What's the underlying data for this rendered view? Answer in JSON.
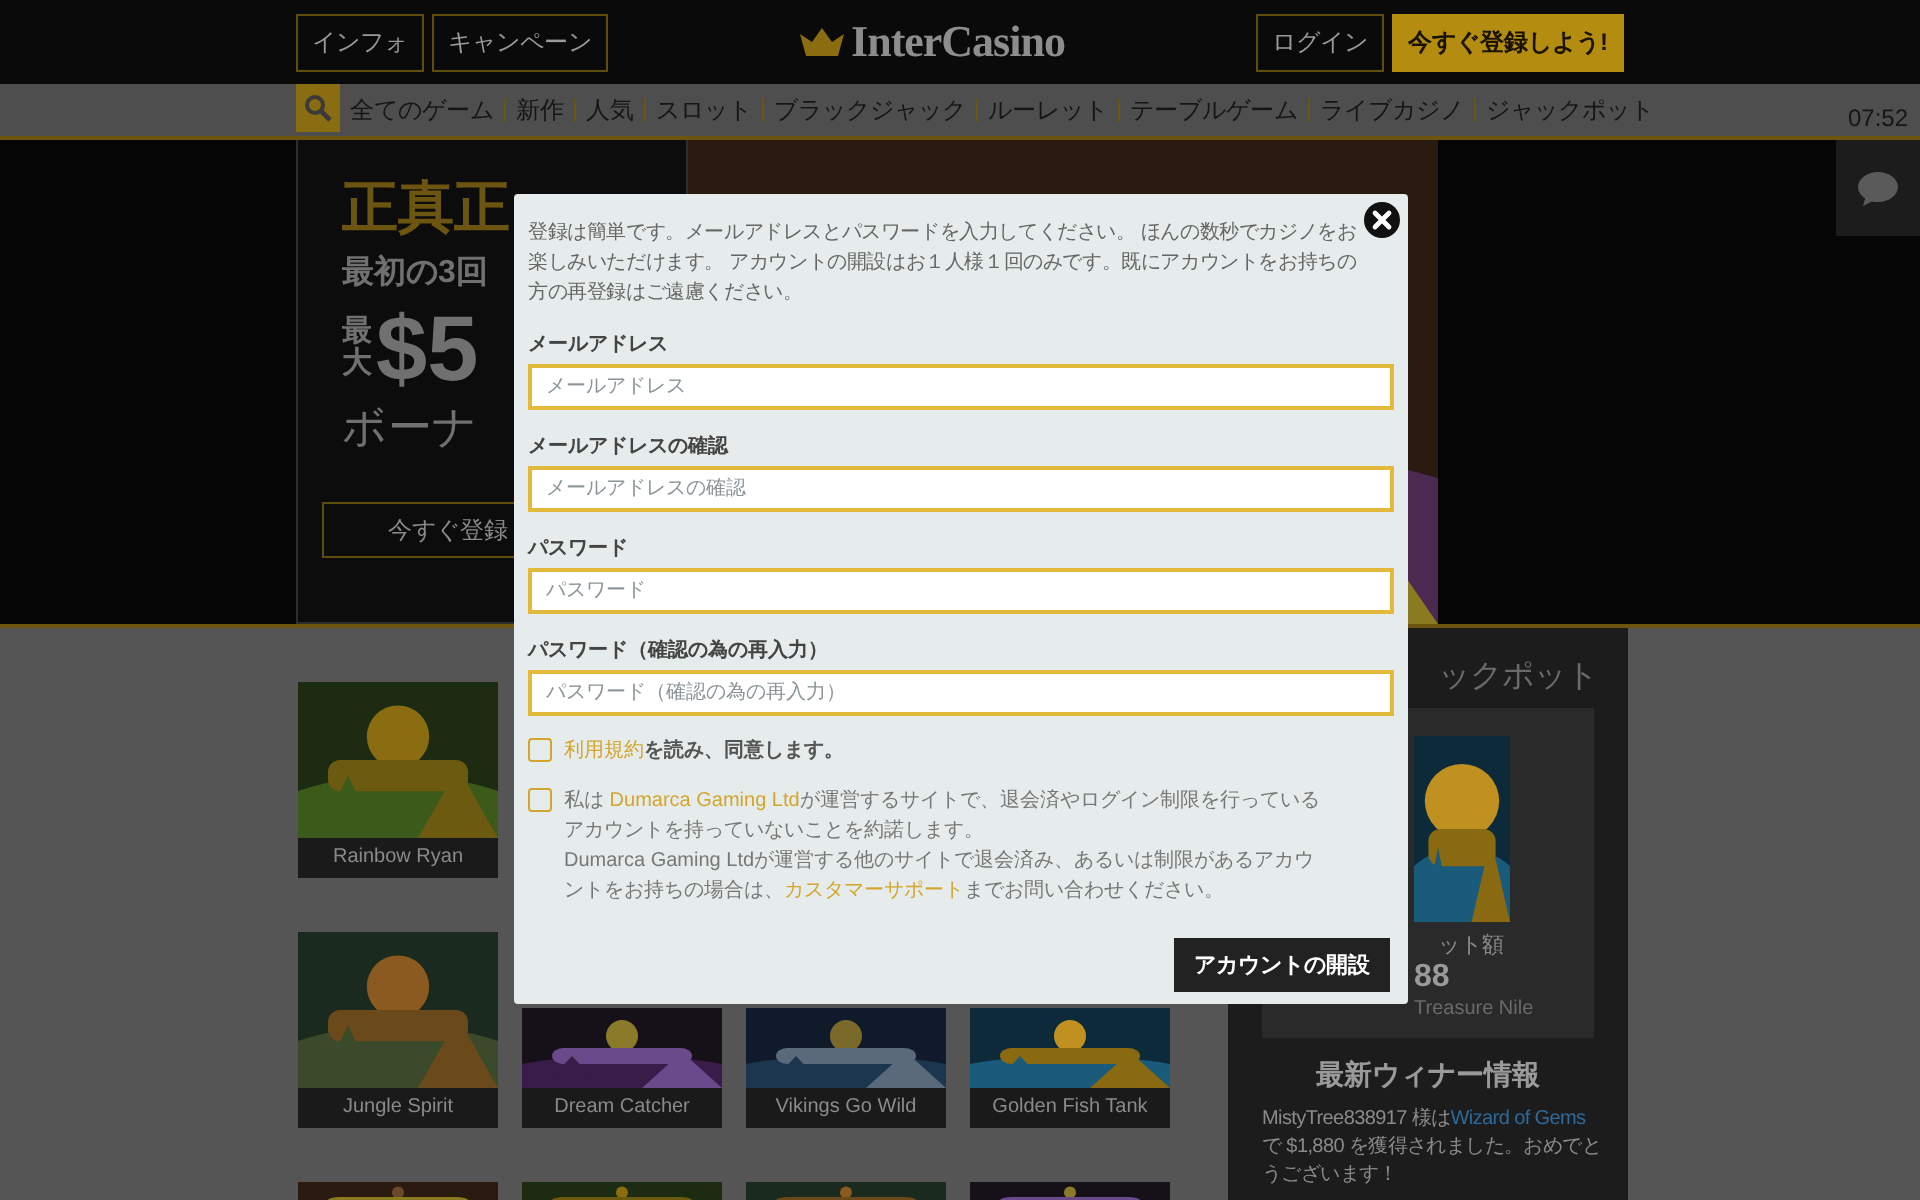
{
  "header": {
    "left_buttons": [
      "インフォ",
      "キャンペーン"
    ],
    "logo": "InterCasino",
    "login": "ログイン",
    "register": "今すぐ登録しよう!"
  },
  "nav": {
    "items": [
      "全てのゲーム",
      "新作",
      "人気",
      "スロット",
      "ブラックジャック",
      "ルーレット",
      "テーブルゲーム",
      "ライブカジノ",
      "ジャックポット"
    ],
    "time": "07:52"
  },
  "hero": {
    "headline": "正真正",
    "line2": "最初の3回",
    "amount_prefix": "最大",
    "amount": "$5",
    "line4": "ボーナ",
    "button": "今すぐ登録"
  },
  "games": [
    [
      {
        "kind": "tile",
        "title": "Rainbow Ryan"
      }
    ],
    [
      {
        "kind": "tile",
        "title": "Jungle Spirit"
      },
      {
        "kind": "tile",
        "title": "Dream Catcher"
      },
      {
        "kind": "tile",
        "title": "Vikings Go Wild"
      },
      {
        "kind": "tile",
        "title": "Golden Fish Tank"
      }
    ],
    [
      {
        "kind": "picture"
      },
      {
        "kind": "picture"
      },
      {
        "kind": "picture"
      },
      {
        "kind": "picture"
      }
    ]
  ],
  "sidebar": {
    "jackpot_heading": "ックポット",
    "jackpot_label": "ット額",
    "jackpot_amount": "88",
    "jackpot_game": "Treasure Nile",
    "winners_heading": "最新ウィナー情報",
    "winner": {
      "before": "MistyTree838917 様は",
      "link": "Wizard of Gems",
      "after": " で $1,880 を獲得されました。おめでとうございます！"
    }
  },
  "modal": {
    "intro": "登録は簡単です。メールアドレスとパスワードを入力してください。 ほんの数秒でカジノをお楽しみいただけます。 アカウントの開設はお１人様１回のみです。既にアカウントをお持ちの方の再登録はご遠慮ください。",
    "fields": [
      {
        "label": "メールアドレス",
        "placeholder": "メールアドレス"
      },
      {
        "label": "メールアドレスの確認",
        "placeholder": "メールアドレスの確認"
      },
      {
        "label": "パスワード",
        "placeholder": "パスワード"
      },
      {
        "label": "パスワード（確認の為の再入力）",
        "placeholder": "パスワード（確認の為の再入力）"
      }
    ],
    "checks": [
      {
        "checked": false,
        "kind": "bold",
        "paragraphs": [
          [
            {
              "text": "利用規約",
              "kind": "link"
            },
            {
              "text": "を読み、同意します。",
              "kind": "text"
            }
          ]
        ]
      },
      {
        "checked": false,
        "kind": "plain",
        "paragraphs": [
          [
            {
              "text": "私は ",
              "kind": "text"
            },
            {
              "text": "Dumarca Gaming Ltd",
              "kind": "link"
            },
            {
              "text": "が運営するサイトで、退会済やログイン制限を行っているアカウントを持っていないことを約諾します。",
              "kind": "text"
            }
          ],
          [
            {
              "text": "Dumarca Gaming Ltdが運営する他のサイトで退会済み、あるいは制限があるアカウントをお持ちの場合は、",
              "kind": "text"
            },
            {
              "text": "カスタマーサポート",
              "kind": "link"
            },
            {
              "text": "までお問い合わせください。",
              "kind": "text"
            }
          ]
        ]
      }
    ],
    "submit": "アカウントの開設"
  }
}
